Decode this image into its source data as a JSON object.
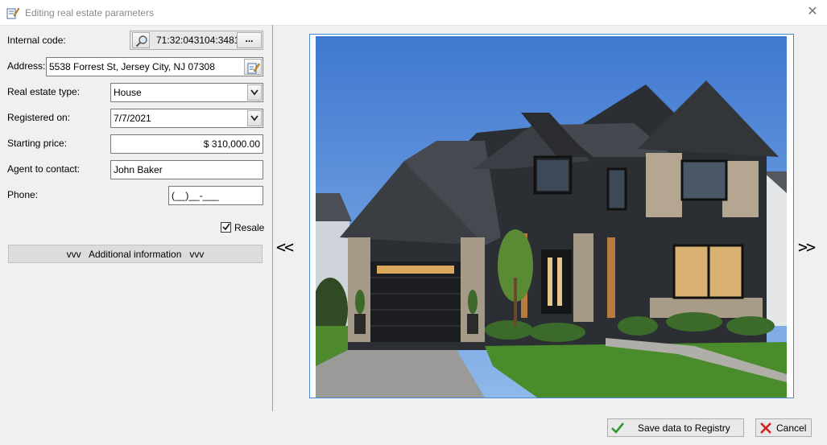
{
  "window": {
    "title": "Editing real estate parameters",
    "close_glyph": "✕"
  },
  "form": {
    "internal_code": {
      "label": "Internal code:",
      "value": "71:32:043104:3481",
      "more_label": "..."
    },
    "address": {
      "label": "Address:",
      "value": "5538 Forrest St,  Jersey City, NJ 07308"
    },
    "type": {
      "label": "Real estate type:",
      "value": "House"
    },
    "registered": {
      "label": "Registered on:",
      "value": "7/7/2021"
    },
    "price": {
      "label": "Starting price:",
      "value": "$ 310,000.00"
    },
    "agent": {
      "label": "Agent to contact:",
      "value": "John Baker"
    },
    "phone": {
      "label": "Phone:",
      "value": "(__)__-___"
    },
    "resale": {
      "label": "Resale",
      "checked": true
    },
    "additional": {
      "label": "vvv   Additional information   vvv"
    }
  },
  "viewer": {
    "prev": "<<",
    "next": ">>"
  },
  "footer": {
    "save_label": "Save data to Registry",
    "cancel_label": "Cancel"
  },
  "colors": {
    "accent_border": "#4a8ad4",
    "save_check": "#2e9a2e",
    "cancel_x": "#d02020"
  },
  "icons": [
    "edit-document-icon",
    "magnifier-icon",
    "edit-address-icon",
    "chevron-down-icon",
    "checkmark-icon",
    "cancel-x-icon",
    "close-icon"
  ]
}
